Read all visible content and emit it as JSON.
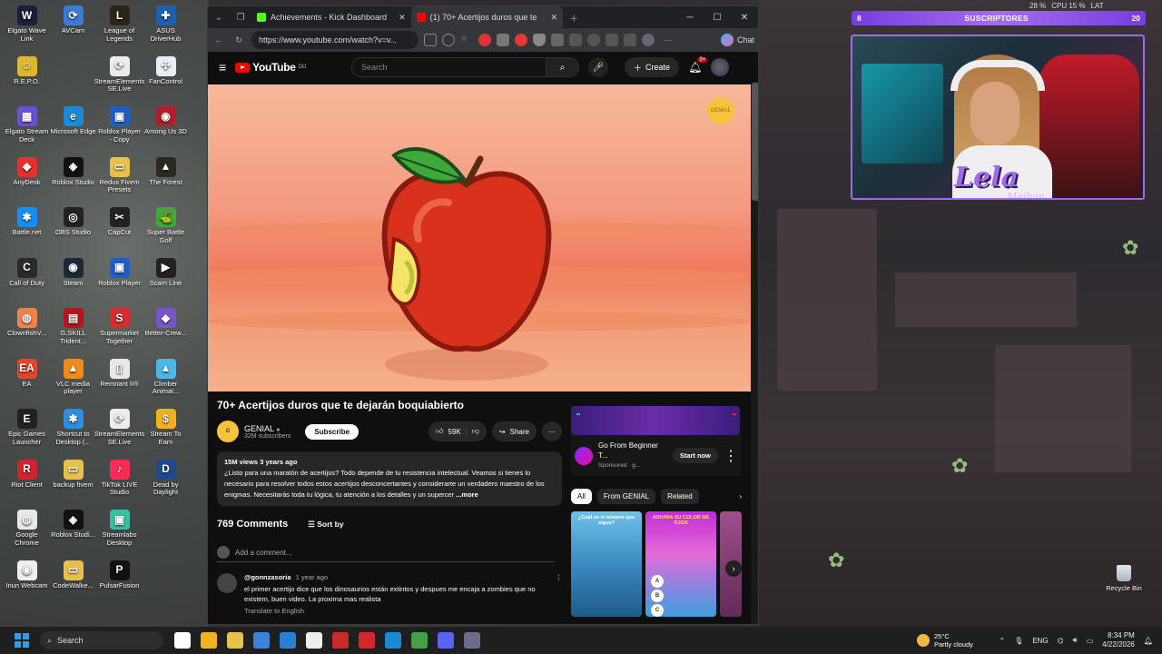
{
  "desktop": {
    "icons": [
      {
        "label": "Elgato Wave Link",
        "color": "#1e1e3a",
        "glyph": "W"
      },
      {
        "label": "AVCam",
        "color": "#3b7bd6",
        "glyph": "⟳"
      },
      {
        "label": "League of Legends",
        "color": "#2b2418",
        "glyph": "L"
      },
      {
        "label": "ASUS DriverHub",
        "color": "#1f5fb0",
        "glyph": "✚"
      },
      {
        "label": "R.E.P.O.",
        "color": "#e0b62a",
        "glyph": "☺"
      },
      {
        "label": "",
        "color": "transparent",
        "glyph": ""
      },
      {
        "label": "StreamElements SE.Live",
        "color": "#ececec",
        "glyph": "⟳"
      },
      {
        "label": "FanControl",
        "color": "#e8eef4",
        "glyph": "✣"
      },
      {
        "label": "Elgato Stream Deck",
        "color": "#6a4fd8",
        "glyph": "▦"
      },
      {
        "label": "Microsoft Edge",
        "color": "#1a8ad4",
        "glyph": "e"
      },
      {
        "label": "Roblox Player - Copy",
        "color": "#1d5fc9",
        "glyph": "▣"
      },
      {
        "label": "Among Us 3D",
        "color": "#b21d2a",
        "glyph": "◉"
      },
      {
        "label": "AnyDesk",
        "color": "#e5312b",
        "glyph": "◆"
      },
      {
        "label": "Roblox Studio",
        "color": "#111",
        "glyph": "◈"
      },
      {
        "label": "Redux Fivem Presets",
        "color": "#e8c14a",
        "glyph": "▭"
      },
      {
        "label": "The Forest",
        "color": "#2a2a20",
        "glyph": "▲"
      },
      {
        "label": "Battle.net",
        "color": "#148eff",
        "glyph": "✱"
      },
      {
        "label": "OBS Studio",
        "color": "#222",
        "glyph": "◎"
      },
      {
        "label": "CapCut",
        "color": "#222",
        "glyph": "✂"
      },
      {
        "label": "Super Battle Golf",
        "color": "#3ea83a",
        "glyph": "⛳"
      },
      {
        "label": "Call of Duty",
        "color": "#2a2a2a",
        "glyph": "C"
      },
      {
        "label": "Steam",
        "color": "#1b2838",
        "glyph": "◉"
      },
      {
        "label": "Roblox Player",
        "color": "#1d5fc9",
        "glyph": "▣"
      },
      {
        "label": "Scam Line",
        "color": "#222",
        "glyph": "▶"
      },
      {
        "label": "ClownfishV...",
        "color": "#f0814a",
        "glyph": "◍"
      },
      {
        "label": "G.SKILL Trident...",
        "color": "#b8151a",
        "glyph": "▤"
      },
      {
        "label": "Supermarket Together",
        "color": "#d62d30",
        "glyph": "S"
      },
      {
        "label": "Better-Crew...",
        "color": "#7a55c8",
        "glyph": "◆"
      },
      {
        "label": "EA",
        "color": "#e3462a",
        "glyph": "EA"
      },
      {
        "label": "VLC media player",
        "color": "#f08a1c",
        "glyph": "▲"
      },
      {
        "label": "Remnant II®",
        "color": "#e8e8e8",
        "glyph": "▯"
      },
      {
        "label": "Climber Animal...",
        "color": "#4bb7e6",
        "glyph": "▲"
      },
      {
        "label": "Epic Games Launcher",
        "color": "#222",
        "glyph": "E"
      },
      {
        "label": "Shortcut to Desktop (...",
        "color": "#2f8ee0",
        "glyph": "✱"
      },
      {
        "label": "StreamElements SE.Live",
        "color": "#ececec",
        "glyph": "⟳"
      },
      {
        "label": "Stream To Earn",
        "color": "#f2b01e",
        "glyph": "$"
      },
      {
        "label": "Riot Client",
        "color": "#d1242f",
        "glyph": "R"
      },
      {
        "label": "backup fivem",
        "color": "#e8c14a",
        "glyph": "▭"
      },
      {
        "label": "TikTok LIVE Studio",
        "color": "#fe2c55",
        "glyph": "♪"
      },
      {
        "label": "Dead by Daylight",
        "color": "#1e4a8a",
        "glyph": "D"
      },
      {
        "label": "Google Chrome",
        "color": "#e8e8e8",
        "glyph": "◍"
      },
      {
        "label": "Roblox Studi...",
        "color": "#111",
        "glyph": "◈"
      },
      {
        "label": "Streamlabs Desktop",
        "color": "#31c3a2",
        "glyph": "▣"
      },
      {
        "label": "",
        "color": "transparent",
        "glyph": ""
      },
      {
        "label": "Iriun Webcam",
        "color": "#eee",
        "glyph": "◉"
      },
      {
        "label": "CodeWalke...",
        "color": "#e8c14a",
        "glyph": "▭"
      },
      {
        "label": "PulsarFusion",
        "color": "#111",
        "glyph": "P"
      }
    ],
    "recycle_label": "Recycle Bin"
  },
  "browser": {
    "tabs": [
      {
        "label": "Achievements - Kick Dashboard",
        "fav_color": "#53fc18"
      },
      {
        "label": "(1) 70+ Acertijos duros que te deja...",
        "fav_color": "#ff0000"
      }
    ],
    "url": "https://www.youtube.com/watch?v=v...",
    "chat_label": "Chat"
  },
  "youtube": {
    "logo_text": "YouTube",
    "logo_country": "DO",
    "search_placeholder": "Search",
    "create_label": "Create",
    "notif_count": "9+",
    "player_watermark": "GENIAL",
    "video_title": "70+ Acertijos duros que te dejarán boquiabierto",
    "channel_name": "GENIAL",
    "channel_subs": "32M subscribers",
    "subscribe_label": "Subscribe",
    "likes": "59K",
    "share_label": "Share",
    "desc_meta": "15M views  3 years ago",
    "desc_text": "¿Listo para una maratón de acertijos? Todo depende de tu resistencia intelectual. Veamos si tienes lo necesario para resolver todos estos acertijos desconcertantes y considerarte un verdadero maestro de los enigmas. Necesitarás toda tu lógica, tu atención a los detalles y un supercer",
    "desc_more": "...more",
    "comments_count": "769 Comments",
    "sort_label": "Sort by",
    "add_comment": "Add a comment...",
    "comment": {
      "user": "@gonnzasoria",
      "ago": "1 year ago",
      "text": "el primer acertijo dice que los dinosaurios están extintos y despues me encaja a zombies que no existem, buen video. La proxima mas realista",
      "translate": "Translate to English"
    },
    "ad": {
      "title": "Go From Beginner T...",
      "sponsored": "Sponsored · g...",
      "cta": "Start now"
    },
    "chips": [
      "All",
      "From GENIAL",
      "Related"
    ],
    "thumbs": [
      {
        "caption": "¿Cuál es el número que sigue?"
      },
      {
        "caption": "ADIVINA SU COLOR DE OJOS"
      }
    ]
  },
  "overlay": {
    "subs_count_left": "8",
    "subs_label": "SUSCRIPTORES",
    "subs_count_right": "20",
    "perf_a": "28 %",
    "perf_cpu": "CPU 15 %",
    "perf_lat": "LAT",
    "signature": "Lela",
    "signature2": "Meihan"
  },
  "taskbar": {
    "search_label": "Search",
    "weather_temp": "25°C",
    "weather_desc": "Partly cloudy",
    "lang": "ENG",
    "time": "8:34 PM",
    "date": "4/22/2026",
    "apps": [
      "#ffffff",
      "#f2b320",
      "#e8c14a",
      "#3d82d6",
      "#2a7fd3",
      "#eeeeee",
      "#cc2a2a",
      "#d6262b",
      "#1a8ad4",
      "#43a047",
      "#5865f2",
      "#6b6b8a"
    ]
  }
}
